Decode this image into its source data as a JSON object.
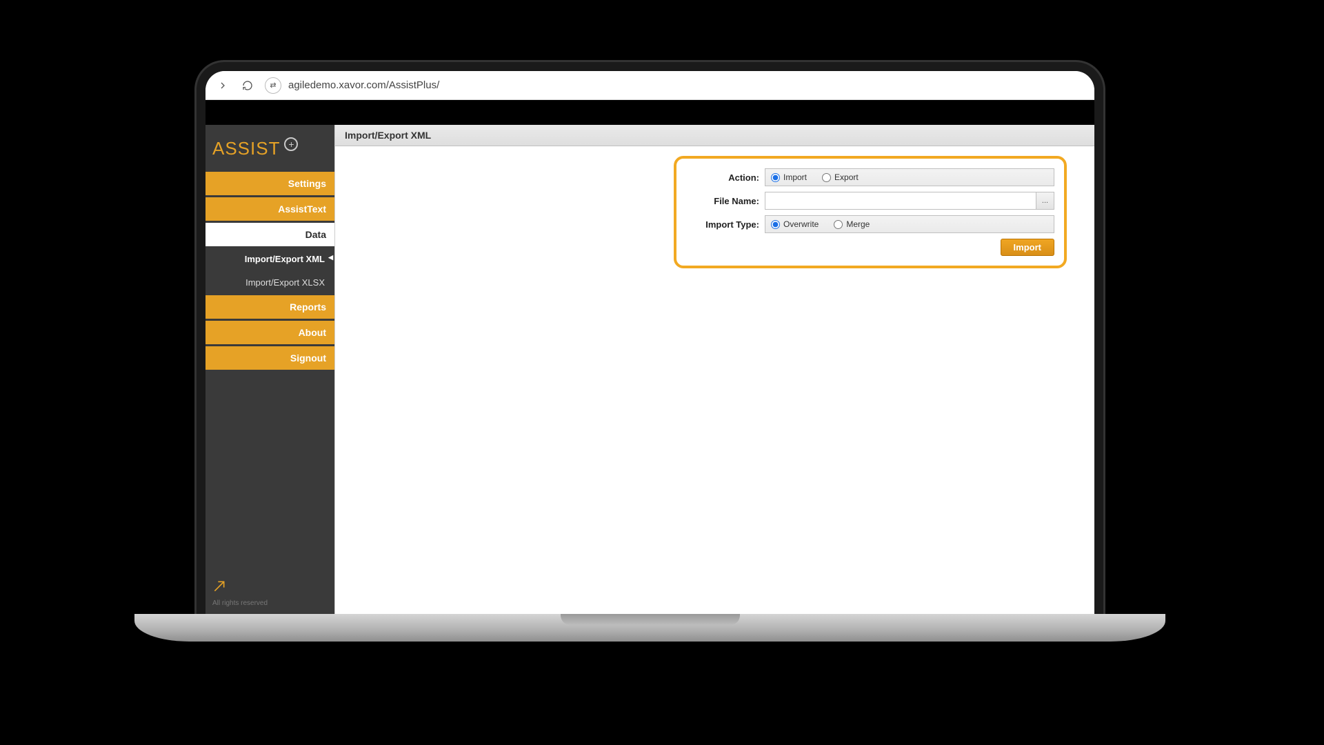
{
  "browser": {
    "url": "agiledemo.xavor.com/AssistPlus/",
    "site_chip": "⇄"
  },
  "logo": {
    "text": "ASSIST",
    "plus": "+"
  },
  "nav": {
    "items": [
      {
        "label": "Settings",
        "active": false
      },
      {
        "label": "AssistText",
        "active": false
      },
      {
        "label": "Data",
        "active": true
      },
      {
        "label": "Reports",
        "active": false
      },
      {
        "label": "About",
        "active": false
      },
      {
        "label": "Signout",
        "active": false
      }
    ],
    "sub": [
      {
        "label": "Import/Export XML",
        "selected": true
      },
      {
        "label": "Import/Export XLSX",
        "selected": false
      }
    ]
  },
  "page": {
    "title": "Import/Export XML"
  },
  "form": {
    "action_label": "Action:",
    "action_options": {
      "import": "Import",
      "export": "Export"
    },
    "action_selected": "import",
    "filename_label": "File Name:",
    "filename_value": "",
    "browse_label": "...",
    "importtype_label": "Import Type:",
    "importtype_options": {
      "overwrite": "Overwrite",
      "merge": "Merge"
    },
    "importtype_selected": "overwrite",
    "submit_label": "Import"
  },
  "footer": {
    "rights": "All rights reserved"
  }
}
